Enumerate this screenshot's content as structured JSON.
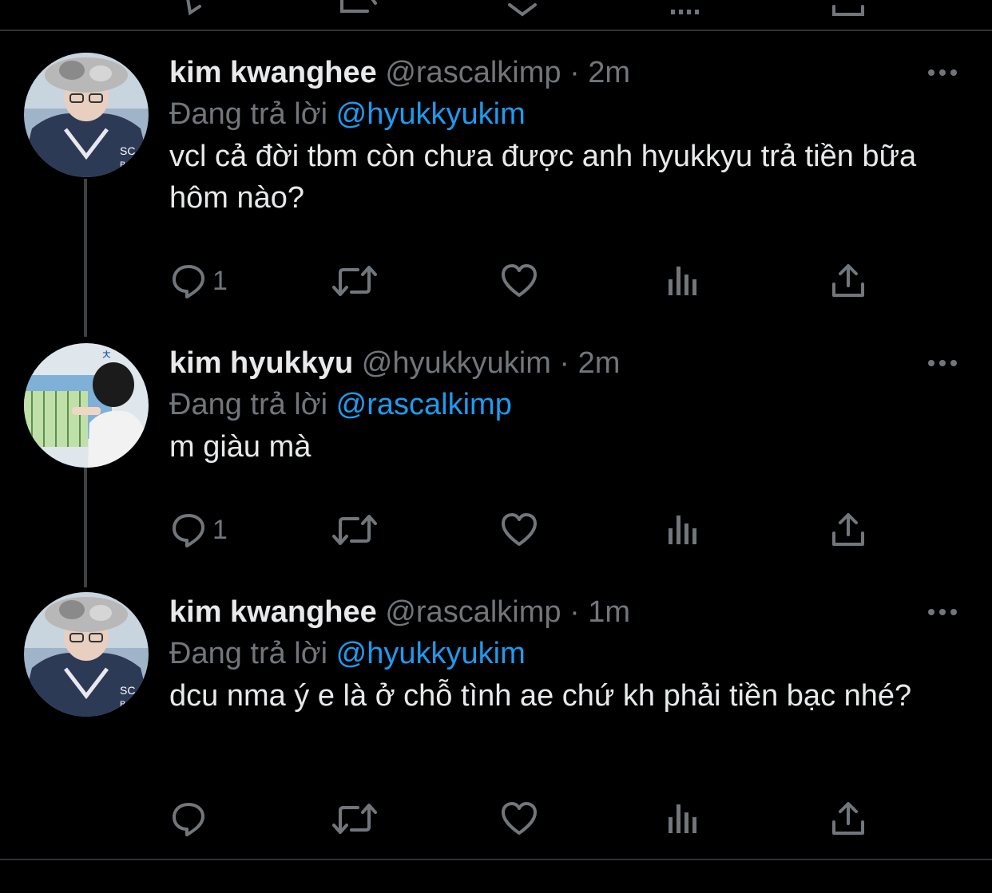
{
  "app": {
    "accent_color": "#1d9bf0",
    "background": "#000000",
    "muted_color": "#71767b",
    "text_color": "#e7e9ea"
  },
  "tweets": [
    {
      "name": "kim kwanghee",
      "handle": "@rascalkimp",
      "separator": "·",
      "time": "2m",
      "replying_label": "Đang trả lời",
      "replying_to": "@hyukkyukim",
      "text": "vcl cả đời tbm còn chưa được anh hyukkyu trả tiền bữa hôm nào?",
      "reply_count": "1",
      "avatar": "avatar-kwanghee"
    },
    {
      "name": "kim hyukkyu",
      "handle": "@hyukkyukim",
      "separator": "·",
      "time": "2m",
      "replying_label": "Đang trả lời",
      "replying_to": "@rascalkimp",
      "text": "m giàu mà",
      "reply_count": "1",
      "avatar": "avatar-hyukkyu"
    },
    {
      "name": "kim kwanghee",
      "handle": "@rascalkimp",
      "separator": "·",
      "time": "1m",
      "replying_label": "Đang trả lời",
      "replying_to": "@hyukkyukim",
      "text": "dcu nma ý e là ở chỗ tình ae chứ kh phải tiền bạc nhé?",
      "reply_count": "",
      "avatar": "avatar-kwanghee"
    }
  ],
  "icons": {
    "reply": "reply-icon",
    "retweet": "retweet-icon",
    "like": "heart-icon",
    "views": "analytics-icon",
    "share": "share-icon",
    "more": "more-icon"
  }
}
